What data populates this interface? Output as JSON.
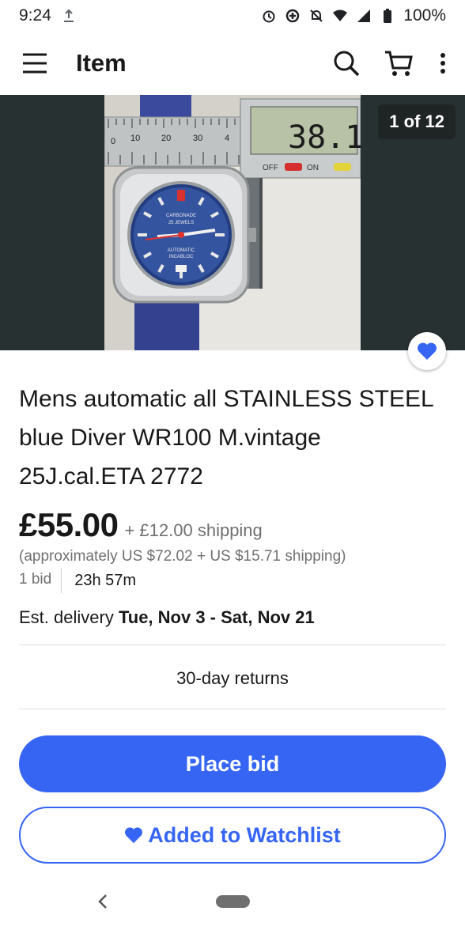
{
  "status_bar": {
    "time": "9:24",
    "battery": "100%",
    "icons": [
      "upload-icon",
      "alarm-icon",
      "data-saver-icon",
      "notifications-off-icon",
      "wifi-icon",
      "signal-icon",
      "battery-icon"
    ]
  },
  "appbar": {
    "title": "Item",
    "icons": [
      "menu-icon",
      "search-icon",
      "cart-icon",
      "more-vert-icon"
    ]
  },
  "hero": {
    "counter": "1 of 12",
    "favorite_icon": "heart-icon",
    "photo_text": {
      "ruler_numbers": [
        "0",
        "10",
        "20",
        "30",
        "4"
      ],
      "display": "38.1",
      "off": "OFF",
      "on": "ON",
      "dial_brand": "CARBONADE",
      "dial_jewels": "25 JEWELS",
      "dial_automatic": "AUTOMATIC",
      "dial_incabloc": "INCABLOC"
    }
  },
  "listing": {
    "title": "Mens automatic all STAINLESS STEEL blue Diver WR100 M.vintage 25J.cal.ETA 2772",
    "price": "£55.00",
    "shipping": "+ £12.00 shipping",
    "approx": "(approximately US $72.02 + US $15.71 shipping)",
    "bids": "1 bid",
    "time_left": "23h 57m",
    "delivery_prefix": "Est. delivery",
    "delivery_dates": "Tue, Nov 3 - Sat, Nov 21",
    "returns": "30-day returns"
  },
  "actions": {
    "place_bid": "Place bid",
    "watchlist": "Added to Watchlist"
  },
  "colors": {
    "accent": "#3665f3",
    "text": "#191919",
    "muted": "#707070"
  }
}
